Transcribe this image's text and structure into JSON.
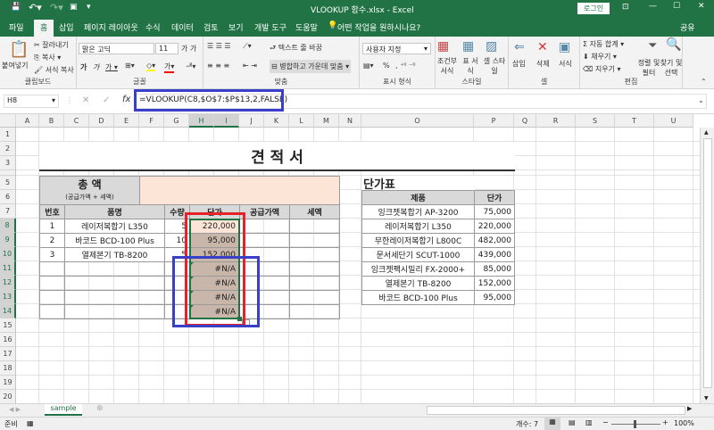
{
  "window": {
    "title": "VLOOKUP 함수.xlsx  -  Excel",
    "login": "로그인",
    "share": "공유"
  },
  "tabs": [
    "파일",
    "홈",
    "삽입",
    "페이지 레이아웃",
    "수식",
    "데이터",
    "검토",
    "보기",
    "개발 도구",
    "도움말"
  ],
  "tell_me": "어떤 작업을 원하시나요?",
  "ribbon": {
    "clipboard": {
      "paste": "붙여넣기",
      "cut": "잘라내기",
      "copy": "복사",
      "format_painter": "서식 복사",
      "label": "클립보드"
    },
    "font": {
      "name": "맑은 고딕",
      "size": "11",
      "label": "글꼴"
    },
    "align": {
      "wrap": "텍스트 줄 바꿈",
      "merge": "병합하고 가운데 맞춤",
      "label": "맞춤"
    },
    "number": {
      "format": "사용자 지정",
      "percent": "%",
      "label": "표시 형식"
    },
    "styles": {
      "cond": "조건부 서식",
      "table": "표 서식",
      "cell": "셀 스타일",
      "label": "스타일"
    },
    "cells": {
      "insert": "삽입",
      "delete": "삭제",
      "format": "서식",
      "label": "셀"
    },
    "edit": {
      "autosum": "자동 합계",
      "fill": "채우기",
      "clear": "지우기",
      "sort": "정렬 및 필터",
      "find": "찾기 및 선택",
      "label": "편집"
    }
  },
  "formula_bar": {
    "name_box": "H8",
    "formula": "=VLOOKUP(C8,$O$7:$P$13,2,FALSE)"
  },
  "columns": [
    "A",
    "B",
    "C",
    "D",
    "E",
    "F",
    "G",
    "H",
    "I",
    "J",
    "K",
    "L",
    "M",
    "N",
    "O",
    "P",
    "Q",
    "R",
    "S",
    "T",
    "U"
  ],
  "rows": [
    "1",
    "2",
    "3",
    "4",
    "5",
    "6",
    "7",
    "8",
    "9",
    "10",
    "11",
    "12",
    "13",
    "14",
    "15",
    "16",
    "17",
    "18",
    "19",
    "20"
  ],
  "cells": [
    {
      "ref": "B2:P3",
      "text": "견 적 서"
    },
    {
      "ref": "B5:E5",
      "text": "총 액"
    },
    {
      "ref": "B6:E6",
      "text": "(공급가액 + 세액)"
    },
    {
      "ref": "F5:M6",
      "text": ""
    },
    {
      "ref": "B7",
      "text": "번호"
    },
    {
      "ref": "C7:F7",
      "text": "품명"
    },
    {
      "ref": "G7",
      "text": "수량"
    },
    {
      "ref": "H7:I7",
      "text": "단가"
    },
    {
      "ref": "J7:K7",
      "text": "공급가액"
    },
    {
      "ref": "L7:M7",
      "text": "세액"
    },
    {
      "ref": "B8",
      "text": "1"
    },
    {
      "ref": "C8:F8",
      "text": "레이저복합기 L350"
    },
    {
      "ref": "G8",
      "text": "5"
    },
    {
      "ref": "H8:I8",
      "text": "220,000"
    },
    {
      "ref": "B9",
      "text": "2"
    },
    {
      "ref": "C9:F9",
      "text": "바코드 BCD-100 Plus"
    },
    {
      "ref": "G9",
      "text": "10"
    },
    {
      "ref": "H9:I9",
      "text": "95,000"
    },
    {
      "ref": "B10",
      "text": "3"
    },
    {
      "ref": "C10:F10",
      "text": "열제본기 TB-8200"
    },
    {
      "ref": "G10",
      "text": "5"
    },
    {
      "ref": "H10:I10",
      "text": "152,000"
    },
    {
      "ref": "H11:I11",
      "text": "#N/A"
    },
    {
      "ref": "H12:I12",
      "text": "#N/A"
    },
    {
      "ref": "H13:I13",
      "text": "#N/A"
    },
    {
      "ref": "H14:I14",
      "text": "#N/A"
    },
    {
      "ref": "O5",
      "text": "단가표"
    },
    {
      "ref": "O6",
      "text": "제품"
    },
    {
      "ref": "P6",
      "text": "단가"
    },
    {
      "ref": "O7",
      "text": "잉크젯복합기 AP-3200"
    },
    {
      "ref": "P7",
      "text": "75,000"
    },
    {
      "ref": "O8",
      "text": "레이저복합기 L350"
    },
    {
      "ref": "P8",
      "text": "220,000"
    },
    {
      "ref": "O9",
      "text": "무한레이저복합기 L800C"
    },
    {
      "ref": "P9",
      "text": "482,000"
    },
    {
      "ref": "O10",
      "text": "문서세단기 SCUT-1000"
    },
    {
      "ref": "P10",
      "text": "439,000"
    },
    {
      "ref": "O11",
      "text": "잉크젯팩시밀리 FX-2000+"
    },
    {
      "ref": "P11",
      "text": "85,000"
    },
    {
      "ref": "O12",
      "text": "열제본기 TB-8200"
    },
    {
      "ref": "P12",
      "text": "152,000"
    },
    {
      "ref": "O13",
      "text": "바코드 BCD-100 Plus"
    },
    {
      "ref": "P13",
      "text": "95,000"
    }
  ],
  "sheet_tab": "sample",
  "status": {
    "mode": "준비",
    "count": "개수: 7",
    "zoom": "100%"
  },
  "colors": {
    "excel_green": "#217346",
    "header_gray": "#d9d9d9",
    "peach": "#fce4d6",
    "selection": "#c9b6aa",
    "annotation_red": "#e8202a",
    "annotation_blue": "#3a3fc8"
  }
}
